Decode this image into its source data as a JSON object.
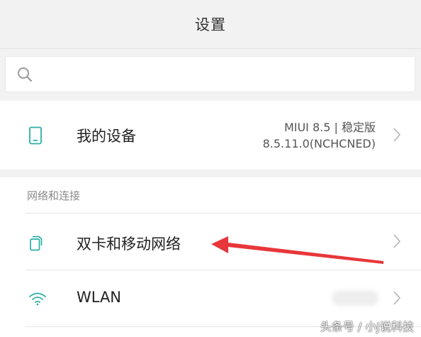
{
  "header": {
    "title": "设置"
  },
  "search": {
    "icon": "search-icon",
    "placeholder": "",
    "value": ""
  },
  "device": {
    "label": "我的设备",
    "icon": "phone-icon",
    "version_line1": "MIUI 8.5 | 稳定版",
    "version_line2": "8.5.11.0(NCHCNED)"
  },
  "network_section": {
    "header": "网络和连接",
    "items": [
      {
        "label": "双卡和移动网络",
        "icon": "sim-cards-icon"
      },
      {
        "label": "WLAN",
        "icon": "wifi-icon",
        "status": ""
      }
    ]
  },
  "annotation": {
    "arrow_color": "#e8363a"
  },
  "watermark": {
    "text": "头条号 / 小J说科技"
  },
  "colors": {
    "accent": "#2bb0a6",
    "background": "#f2f2f2",
    "panel": "#ffffff"
  }
}
